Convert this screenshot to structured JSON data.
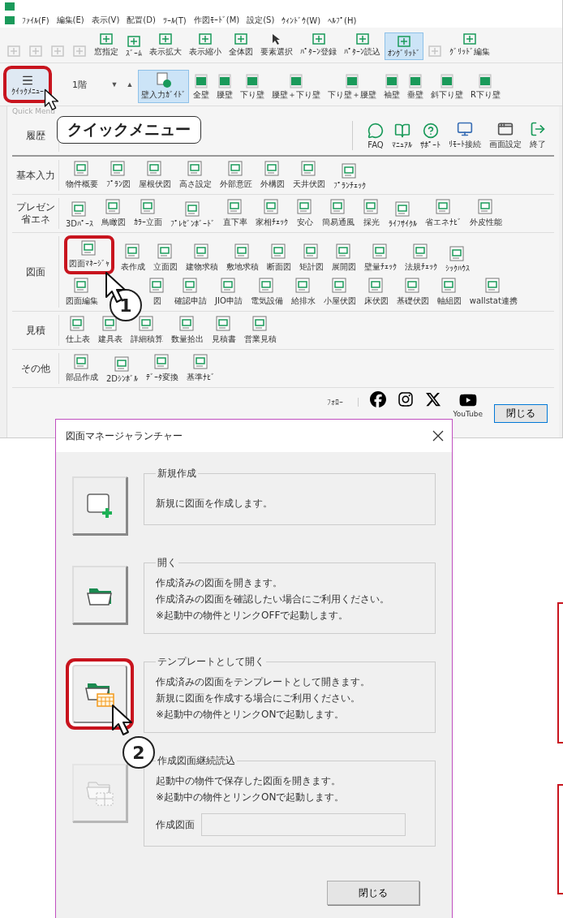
{
  "app": {
    "menu": [
      "ﾌｧｲﾙ(F)",
      "編集(E)",
      "表示(V)",
      "配置(D)",
      "ﾂｰﾙ(T)",
      "作図ﾓｰﾄﾞ(M)",
      "設定(S)",
      "ｳｨﾝﾄﾞｳ(W)",
      "ﾍﾙﾌﾟ(H)"
    ],
    "toolbar_1": [
      {
        "kind": "tool",
        "disabled": true,
        "selected": false
      },
      {
        "kind": "tool",
        "disabled": true,
        "selected": false
      },
      {
        "kind": "tool",
        "disabled": true,
        "selected": false
      },
      {
        "kind": "tool",
        "disabled": true,
        "selected": false
      },
      {
        "kind": "tool",
        "label": "窓指定",
        "disabled": false,
        "selected": false
      },
      {
        "kind": "tool",
        "label": "ｽﾞｰﾑ",
        "disabled": false,
        "selected": false
      },
      {
        "kind": "tool",
        "label": "表示拡大",
        "disabled": false,
        "selected": false
      },
      {
        "kind": "tool",
        "label": "表示縮小",
        "disabled": false,
        "selected": false
      },
      {
        "kind": "tool",
        "label": "全体図",
        "disabled": false,
        "selected": false
      },
      {
        "kind": "pointer",
        "label": "要素選択",
        "disabled": false,
        "selected": false
      },
      {
        "kind": "tool",
        "label": "ﾊﾟﾀｰﾝ登録",
        "disabled": false,
        "selected": false
      },
      {
        "kind": "tool",
        "label": "ﾊﾟﾀｰﾝ読込",
        "disabled": false,
        "selected": false
      },
      {
        "kind": "tool",
        "label": "ｵﾝｸﾞﾘｯﾄﾞ",
        "disabled": false,
        "selected": true
      },
      {
        "kind": "tool",
        "disabled": true,
        "selected": false
      },
      {
        "kind": "tool",
        "label": "ｸﾞﾘｯﾄﾞ編集",
        "disabled": false,
        "selected": false
      }
    ],
    "quick_menu_button": {
      "label": "ｸｲｯｸﾒﾆｭｰ",
      "highlighted": true,
      "callout": "クイックメニュー"
    },
    "floor_select": {
      "value": "1階"
    },
    "floor_buttons": [
      "▼",
      "▲"
    ],
    "toolbar_2": [
      {
        "kind": "guide",
        "label": "壁入力ｶﾞｲﾄﾞ",
        "selected": true
      },
      {
        "kind": "wall",
        "label": "全壁",
        "selected": false
      },
      {
        "kind": "wall",
        "label": "腰壁",
        "selected": false
      },
      {
        "kind": "wall",
        "label": "下り壁",
        "selected": false
      },
      {
        "kind": "wall",
        "label": "腰壁＋下り壁",
        "selected": false
      },
      {
        "kind": "wall",
        "label": "下り壁＋腰壁",
        "selected": false
      },
      {
        "kind": "wall",
        "label": "袖壁",
        "selected": false
      },
      {
        "kind": "wall",
        "label": "垂壁",
        "selected": false
      },
      {
        "kind": "wall",
        "label": "斜下り壁",
        "selected": false
      },
      {
        "kind": "wall",
        "label": "R下り壁",
        "selected": false
      }
    ],
    "quick_menu": {
      "title": "Quick Menu",
      "sections": [
        {
          "label": "履歴",
          "extras": [
            {
              "kind": "chat",
              "label": "FAQ"
            },
            {
              "kind": "book",
              "label": "ﾏﾆｭｱﾙ"
            },
            {
              "kind": "help",
              "label": "ｻﾎﾟｰﾄ"
            },
            {
              "kind": "monitor",
              "label": "ﾘﾓｰﾄ接続"
            },
            {
              "kind": "window",
              "label": "画面設定"
            },
            {
              "kind": "exit",
              "label": "終了"
            }
          ]
        },
        {
          "label": "基本入力",
          "lines": [
            {
              "items": [
                {
                  "label": "物件概要",
                  "highlighted": false
                },
                {
                  "label": "ﾌﾟﾗﾝ図",
                  "highlighted": false
                },
                {
                  "label": "屋根伏図",
                  "highlighted": false
                },
                {
                  "label": "高さ設定",
                  "highlighted": false
                },
                {
                  "label": "外部意匠",
                  "highlighted": false
                },
                {
                  "label": "外構図",
                  "highlighted": false
                },
                {
                  "label": "天井伏図",
                  "highlighted": false
                },
                {
                  "label": "ﾌﾟﾗﾝﾁｪｯｸ",
                  "highlighted": false
                }
              ]
            }
          ]
        },
        {
          "label": "プレゼン省エネ",
          "lines": [
            {
              "items": [
                {
                  "label": "3Dﾊﾟｰｽ",
                  "highlighted": false
                },
                {
                  "label": "鳥瞰図",
                  "highlighted": false
                },
                {
                  "label": "ｶﾗｰ立面",
                  "highlighted": false
                },
                {
                  "label": "ﾌﾟﾚｾﾞﾝﾎﾞｰﾄﾞ",
                  "highlighted": false
                },
                {
                  "label": "直下率",
                  "highlighted": false
                },
                {
                  "label": "家相ﾁｪｯｸ",
                  "highlighted": false
                },
                {
                  "label": "安心",
                  "highlighted": false
                },
                {
                  "label": "簡易通風",
                  "highlighted": false
                },
                {
                  "label": "採光",
                  "highlighted": false
                },
                {
                  "label": "ﾗｲﾌｻｲｸﾙ",
                  "highlighted": false
                },
                {
                  "label": "省エネﾅﾋﾞ",
                  "highlighted": false
                },
                {
                  "label": "外皮性能",
                  "highlighted": false
                }
              ]
            }
          ]
        },
        {
          "label": "図面",
          "lines": [
            {
              "items": [
                {
                  "label": "図面ﾏﾈｰｼﾞｬ",
                  "highlighted": true,
                  "step": "1"
                },
                {
                  "label": "表作成",
                  "highlighted": false
                },
                {
                  "label": "立面図",
                  "highlighted": false
                },
                {
                  "label": "建物求積",
                  "highlighted": false
                },
                {
                  "label": "敷地求積",
                  "highlighted": false
                },
                {
                  "label": "断面図",
                  "highlighted": false
                },
                {
                  "label": "矩計図",
                  "highlighted": false
                },
                {
                  "label": "展開図",
                  "highlighted": false
                },
                {
                  "label": "壁量ﾁｪｯｸ",
                  "highlighted": false
                },
                {
                  "label": "法規ﾁｪｯｸ",
                  "highlighted": false
                },
                {
                  "label": "ｼｯｸﾊｳｽ",
                  "highlighted": false
                }
              ]
            },
            {
              "items": [
                {
                  "label": "図面編集",
                  "highlighted": false
                },
                {
                  "label": "図",
                  "highlighted": false
                },
                {
                  "label": "確認申請",
                  "highlighted": false
                },
                {
                  "label": "JIO申請",
                  "highlighted": false
                },
                {
                  "label": "電気設備",
                  "highlighted": false
                },
                {
                  "label": "給排水",
                  "highlighted": false
                },
                {
                  "label": "小屋伏図",
                  "highlighted": false
                },
                {
                  "label": "床伏図",
                  "highlighted": false
                },
                {
                  "label": "基礎伏図",
                  "highlighted": false
                },
                {
                  "label": "軸組図",
                  "highlighted": false
                },
                {
                  "label": "wallstat連携",
                  "highlighted": false
                }
              ]
            }
          ]
        },
        {
          "label": "見積",
          "lines": [
            {
              "items": [
                {
                  "label": "仕上表",
                  "highlighted": false
                },
                {
                  "label": "建具表",
                  "highlighted": false
                },
                {
                  "label": "詳細積算",
                  "highlighted": false
                },
                {
                  "label": "数量拾出",
                  "highlighted": false
                },
                {
                  "label": "見積書",
                  "highlighted": false
                },
                {
                  "label": "営業見積",
                  "highlighted": false
                }
              ]
            }
          ]
        },
        {
          "label": "その他",
          "lines": [
            {
              "items": [
                {
                  "label": "部品作成",
                  "highlighted": false
                },
                {
                  "label": "2Dｼﾝﾎﾞﾙ",
                  "highlighted": false
                },
                {
                  "label": "ﾃﾞｰﾀ変換",
                  "highlighted": false
                },
                {
                  "label": "基準ﾅﾋﾞ",
                  "highlighted": false
                }
              ]
            }
          ]
        }
      ]
    },
    "footer": {
      "follow_label": "ﾌｫﾛｰ",
      "social": [
        {
          "kind": "facebook"
        },
        {
          "kind": "instagram"
        },
        {
          "kind": "x"
        },
        {
          "kind": "youtube",
          "label": "YouTube"
        }
      ],
      "close_button": "閉じる"
    }
  },
  "dialog": {
    "title": "図面マネージャランチャー",
    "groups": [
      {
        "kind": "new",
        "title": "新規作成",
        "lines": [
          "新規に図面を作成します。"
        ],
        "disabled": false,
        "highlighted": false
      },
      {
        "kind": "open",
        "title": "開く",
        "lines": [
          "作成済みの図面を開きます。",
          "作成済みの図面を確認したい場合にご利用ください。",
          "※起動中の物件とリンクOFFで起動します。"
        ],
        "disabled": false,
        "highlighted": false
      },
      {
        "kind": "template",
        "title": "テンプレートとして開く",
        "lines": [
          "作成済みの図面をテンプレートとして開きます。",
          "新規に図面を作成する場合にご利用ください。",
          "※起動中の物件とリンクONで起動します。"
        ],
        "disabled": false,
        "highlighted": true,
        "step": "2"
      },
      {
        "kind": "continue",
        "title": "作成図面継続読込",
        "lines": [
          "起動中の物件で保存した図面を開きます。",
          "※起動中の物件とリンクONで起動します。"
        ],
        "disabled": true,
        "highlighted": false,
        "field_label": "作成図面"
      }
    ],
    "close_button": "閉じる"
  }
}
